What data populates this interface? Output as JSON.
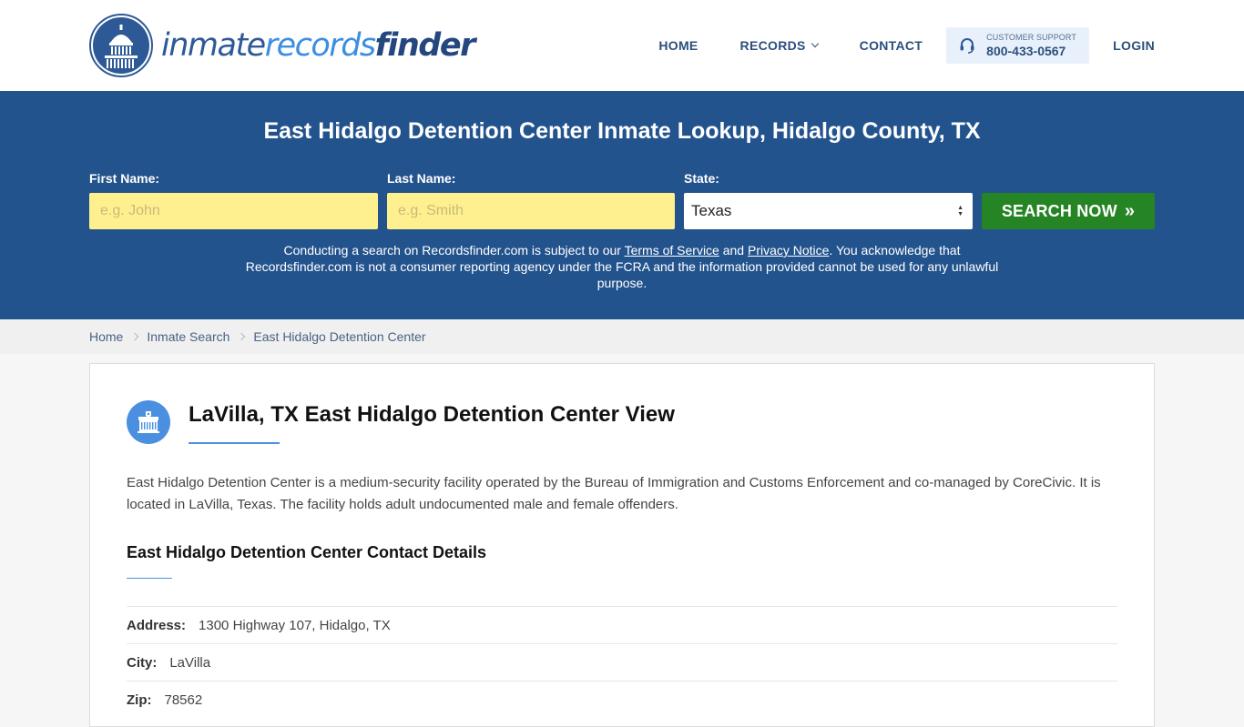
{
  "header": {
    "logo": {
      "part1": "inmate",
      "part2": "records",
      "part3": "finder",
      "icon": "capitol-dome-icon"
    },
    "nav": [
      {
        "label": "HOME"
      },
      {
        "label": "RECORDS",
        "has_dropdown": true
      },
      {
        "label": "CONTACT"
      }
    ],
    "support": {
      "icon": "headset-icon",
      "label": "CUSTOMER SUPPORT",
      "phone": "800-433-0567"
    },
    "login_label": "LOGIN"
  },
  "search": {
    "title": "East Hidalgo Detention Center Inmate Lookup, Hidalgo County, TX",
    "first_name": {
      "label": "First Name:",
      "placeholder": "e.g. John",
      "value": ""
    },
    "last_name": {
      "label": "Last Name:",
      "placeholder": "e.g. Smith",
      "value": ""
    },
    "state": {
      "label": "State:",
      "selected": "Texas"
    },
    "button_label": "SEARCH NOW",
    "button_icon": "double-chevron-right-icon",
    "disclaimer": {
      "before_tos": "Conducting a search on Recordsfinder.com is subject to our ",
      "tos_link": "Terms of Service",
      "between": " and ",
      "privacy_link": "Privacy Notice",
      "after": ". You acknowledge that Recordsfinder.com is not a consumer reporting agency under the FCRA and the information provided cannot be used for any unlawful purpose."
    }
  },
  "breadcrumb": [
    {
      "label": "Home"
    },
    {
      "label": "Inmate Search"
    },
    {
      "label": "East Hidalgo Detention Center"
    }
  ],
  "facility": {
    "icon": "jail-building-icon",
    "title": "LaVilla, TX East Hidalgo Detention Center View",
    "description": "East Hidalgo Detention Center is a medium-security facility operated by the Bureau of Immigration and Customs Enforcement and co-managed by CoreCivic. It is located in LaVilla, Texas. The facility holds adult undocumented male and female offenders.",
    "contact_title": "East Hidalgo Detention Center Contact Details",
    "details": [
      {
        "key": "Address:",
        "value": "1300 Highway 107, Hidalgo, TX"
      },
      {
        "key": "City:",
        "value": "LaVilla"
      },
      {
        "key": "Zip:",
        "value": "78562"
      }
    ]
  },
  "colors": {
    "brand_blue": "#23538d",
    "accent_blue": "#4a8fe0",
    "input_yellow": "#fff08f",
    "button_green": "#258423"
  }
}
